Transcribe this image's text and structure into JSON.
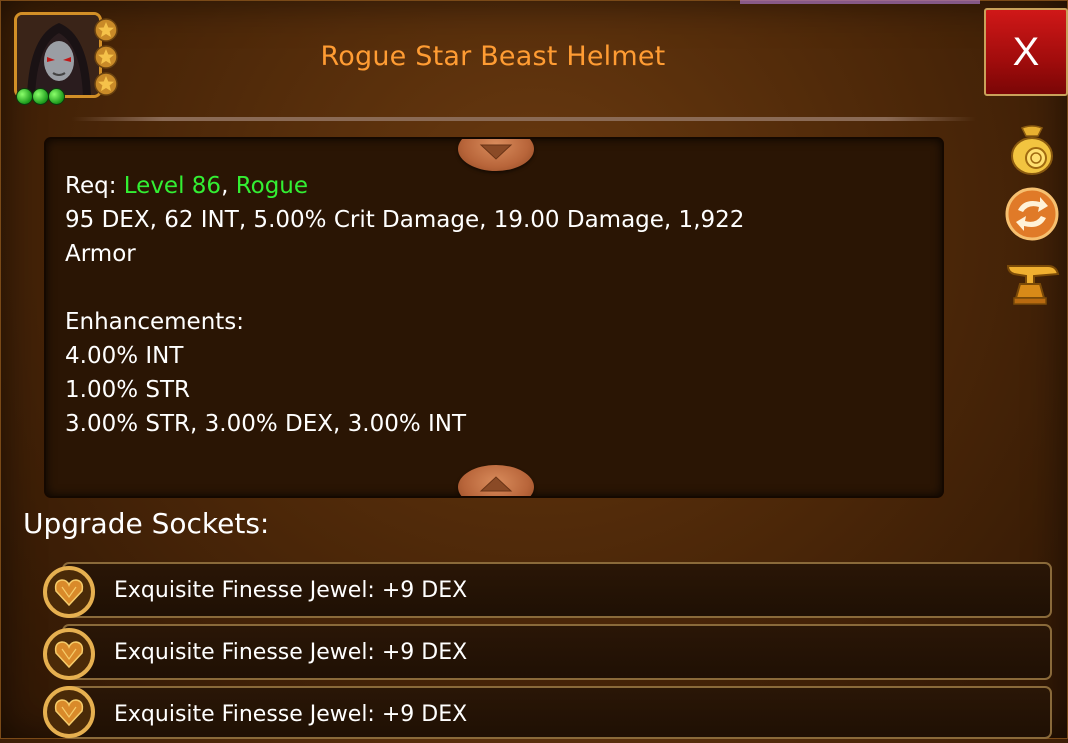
{
  "item": {
    "title": "Rogue Star Beast Helmet"
  },
  "close_button": {
    "label": "X"
  },
  "description": {
    "req_label": "Req: ",
    "req_level": "Level 86",
    "req_sep": ", ",
    "req_class": "Rogue",
    "stats_line1": "95 DEX, 62 INT, 5.00% Crit Damage, 19.00 Damage, 1,922",
    "stats_line2": "Armor",
    "enhancements_heading": "Enhancements:",
    "enhancements": [
      "4.00% INT",
      "1.00% STR",
      "3.00% STR, 3.00% DEX, 3.00% INT"
    ]
  },
  "side_icons": [
    "coin-bag-icon",
    "swap-icon",
    "anvil-icon"
  ],
  "upgrade_sockets": {
    "heading": "Upgrade Sockets:",
    "items": [
      {
        "label": "Exquisite Finesse Jewel: +9 DEX"
      },
      {
        "label": "Exquisite Finesse Jewel: +9 DEX"
      },
      {
        "label": "Exquisite Finesse Jewel: +9 DEX"
      }
    ]
  },
  "colors": {
    "title": "#ff9c33",
    "requirement": "#33ef33",
    "close_button": "#c01010"
  }
}
